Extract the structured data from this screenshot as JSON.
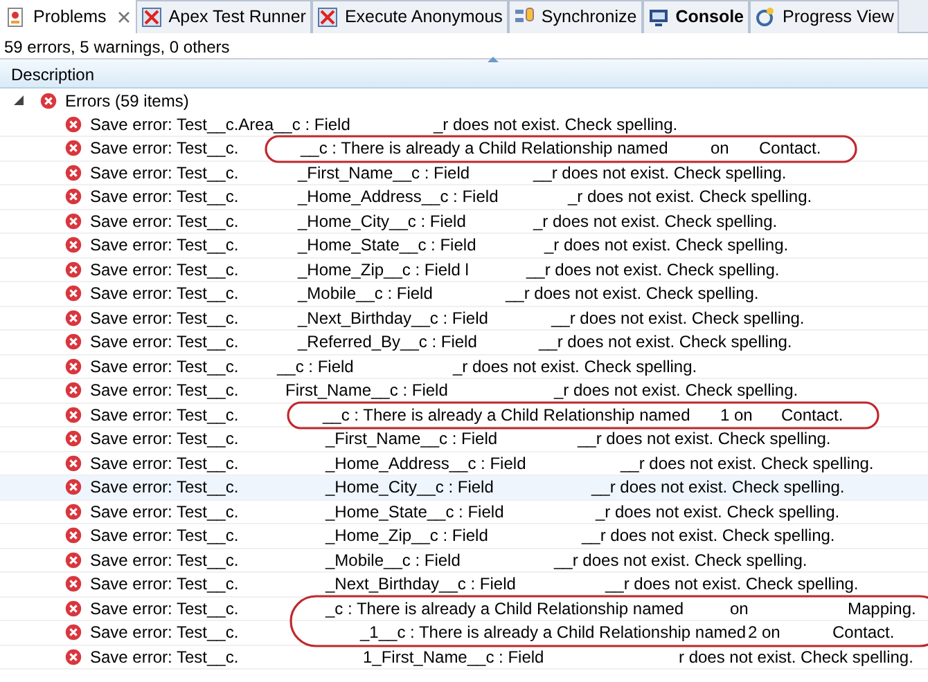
{
  "tabs": [
    {
      "label": "Problems",
      "selected": true,
      "changed": false,
      "closable": true,
      "kind": "problems"
    },
    {
      "label": "Apex Test Runner",
      "selected": false,
      "changed": false,
      "closable": false,
      "kind": "apex"
    },
    {
      "label": "Execute Anonymous",
      "selected": false,
      "changed": false,
      "closable": false,
      "kind": "apex"
    },
    {
      "label": "Synchronize",
      "selected": false,
      "changed": false,
      "closable": false,
      "kind": "sync"
    },
    {
      "label": "Console",
      "selected": false,
      "changed": true,
      "closable": false,
      "kind": "console"
    },
    {
      "label": "Progress View",
      "selected": false,
      "changed": false,
      "closable": false,
      "kind": "progress"
    }
  ],
  "summary": "59 errors, 5 warnings, 0 others",
  "table": {
    "columns": [
      "Description"
    ],
    "group": {
      "label": "Errors (59 items)",
      "expanded": true
    },
    "rows": [
      {
        "parts": [
          "Save error: Test__c.Area__c : Field",
          "_r does not exist. Check spelling."
        ],
        "circled": false,
        "selected": false
      },
      {
        "parts": [
          "Save error: Test__c.",
          "__c : There is already a Child Relationship named",
          "on",
          "Contact."
        ],
        "circled": true,
        "selected": false
      },
      {
        "parts": [
          "Save error: Test__c.",
          "_First_Name__c : Field",
          "__r does not exist. Check spelling."
        ],
        "circled": false,
        "selected": false
      },
      {
        "parts": [
          "Save error: Test__c.",
          "_Home_Address__c : Field",
          "_r does not exist. Check spelling."
        ],
        "circled": false,
        "selected": false
      },
      {
        "parts": [
          "Save error: Test__c.",
          "_Home_City__c : Field",
          "_r does not exist. Check spelling."
        ],
        "circled": false,
        "selected": false
      },
      {
        "parts": [
          "Save error: Test__c.",
          "_Home_State__c : Field",
          "_r does not exist. Check spelling."
        ],
        "circled": false,
        "selected": false
      },
      {
        "parts": [
          "Save error: Test__c.",
          "_Home_Zip__c : Field l",
          "__r does not exist. Check spelling."
        ],
        "circled": false,
        "selected": false
      },
      {
        "parts": [
          "Save error: Test__c.",
          "_Mobile__c : Field",
          "__r does not exist. Check spelling."
        ],
        "circled": false,
        "selected": false
      },
      {
        "parts": [
          "Save error: Test__c.",
          "_Next_Birthday__c : Field",
          "__r does not exist. Check spelling."
        ],
        "circled": false,
        "selected": false
      },
      {
        "parts": [
          "Save error: Test__c.",
          "_Referred_By__c : Field",
          "__r does not exist. Check spelling."
        ],
        "circled": false,
        "selected": false
      },
      {
        "parts": [
          "Save error: Test__c.",
          "__c : Field",
          "_r does not exist. Check spelling."
        ],
        "circled": false,
        "selected": false
      },
      {
        "parts": [
          "Save error: Test__c.",
          "First_Name__c : Field",
          "_r does not exist. Check spelling."
        ],
        "circled": false,
        "selected": false
      },
      {
        "parts": [
          "Save error: Test__c.",
          "__c : There is already a Child Relationship named",
          "1 on",
          "Contact."
        ],
        "circled": true,
        "selected": false
      },
      {
        "parts": [
          "Save error: Test__c.",
          "_First_Name__c : Field",
          "__r does not exist. Check spelling."
        ],
        "circled": false,
        "selected": false
      },
      {
        "parts": [
          "Save error: Test__c.",
          "_Home_Address__c : Field",
          "__r does not exist. Check spelling."
        ],
        "circled": false,
        "selected": false
      },
      {
        "parts": [
          "Save error: Test__c.",
          "_Home_City__c : Field",
          "__r does not exist. Check spelling."
        ],
        "circled": false,
        "selected": true
      },
      {
        "parts": [
          "Save error: Test__c.",
          "_Home_State__c : Field",
          "_r does not exist. Check spelling."
        ],
        "circled": false,
        "selected": false
      },
      {
        "parts": [
          "Save error: Test__c.",
          "_Home_Zip__c : Field",
          "__r does not exist. Check spelling."
        ],
        "circled": false,
        "selected": false
      },
      {
        "parts": [
          "Save error: Test__c.",
          "_Mobile__c : Field",
          "__r does not exist. Check spelling."
        ],
        "circled": false,
        "selected": false
      },
      {
        "parts": [
          "Save error: Test__c.",
          "_Next_Birthday__c : Field",
          "__r does not exist. Check spelling."
        ],
        "circled": false,
        "selected": false
      },
      {
        "parts": [
          "Save error: Test__c.",
          "_c : There is already a Child Relationship named",
          "on",
          "Mapping."
        ],
        "circled": true,
        "selected": false
      },
      {
        "parts": [
          "Save error: Test__c.",
          "_1__c : There is already a Child Relationship named",
          "2 on",
          "Contact."
        ],
        "circled": true,
        "selected": false
      },
      {
        "parts": [
          "Save error: Test__c.",
          "1_First_Name__c : Field",
          "r does not exist. Check spelling."
        ],
        "circled": false,
        "selected": false
      }
    ]
  }
}
